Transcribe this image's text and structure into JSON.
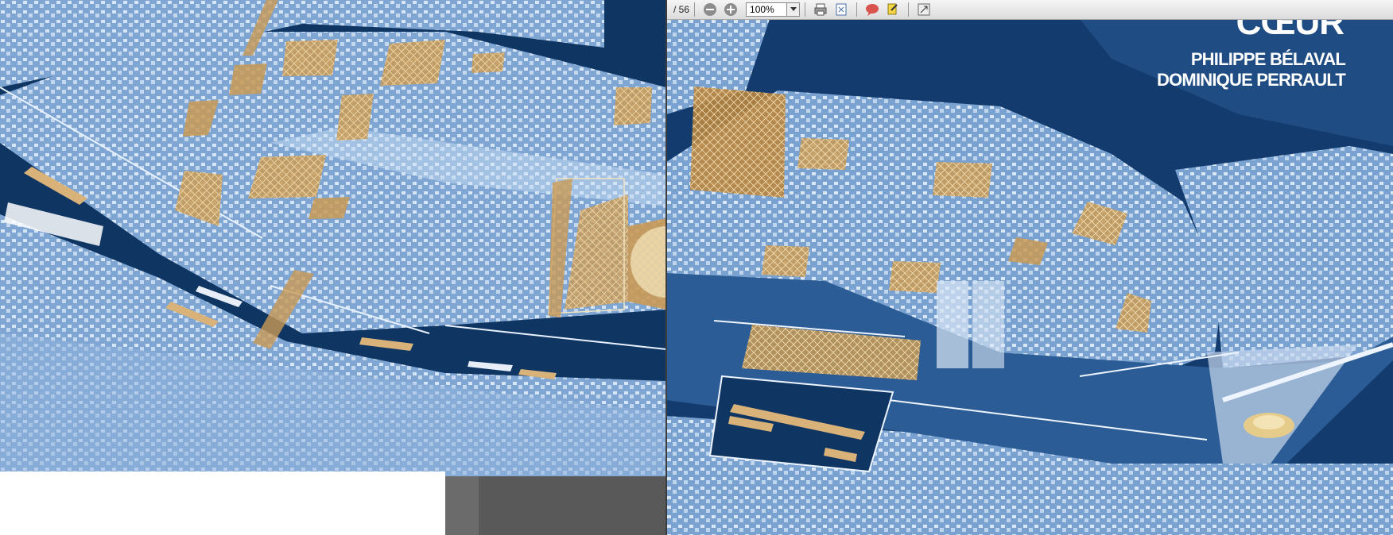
{
  "viewer": {
    "page_indicator": "/ 56",
    "zoom_value": "100%",
    "icons": [
      "zoom-out-icon",
      "zoom-in-icon",
      "print-icon",
      "fit-page-icon",
      "comment-icon",
      "highlight-icon",
      "expand-icon"
    ]
  },
  "cover": {
    "title_fragment": "CŒUR",
    "authors": [
      "PHILIPPE BÉLAVAL",
      "DOMINIQUE PERRAULT"
    ]
  },
  "colors": {
    "river": "#0f3563",
    "city": "#a9c4e4",
    "intervention": "#c99a55",
    "toolbar": "#e4e4e4"
  }
}
